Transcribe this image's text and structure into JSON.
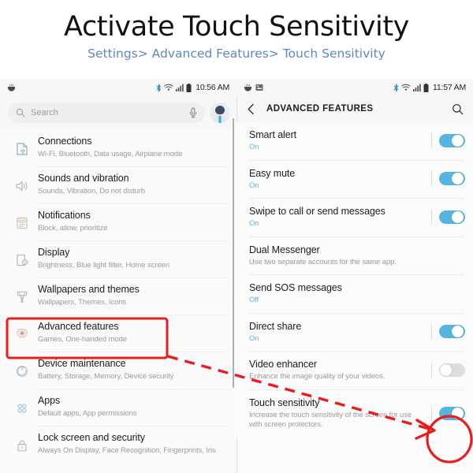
{
  "header": {
    "title": "Activate Touch Sensitivity",
    "breadcrumb": "Settings> Advanced Features> Touch Sensitivity",
    "title_color": "#111111",
    "breadcrumb_color": "#5b87c7"
  },
  "left_phone": {
    "status_bar": {
      "time": "10:56 AM",
      "icons": [
        "app-icon",
        "bluetooth-icon",
        "wifi-icon",
        "signal-icon",
        "battery-icon"
      ]
    },
    "search": {
      "placeholder": "Search",
      "search_icon": "search-icon",
      "mic_icon": "microphone-icon",
      "avatar": "user-avatar"
    },
    "items": [
      {
        "icon": "connections-icon",
        "title": "Connections",
        "sub": "Wi-Fi, Bluetooth, Data usage, Airplane mode"
      },
      {
        "icon": "sound-icon",
        "title": "Sounds and vibration",
        "sub": "Sounds, Vibration, Do not disturb"
      },
      {
        "icon": "notifications-icon",
        "title": "Notifications",
        "sub": "Block, allow, prioritize"
      },
      {
        "icon": "display-icon",
        "title": "Display",
        "sub": "Brightness, Blue light filter, Home screen"
      },
      {
        "icon": "wallpaper-brush-icon",
        "title": "Wallpapers and themes",
        "sub": "Wallpapers, Themes, Icons"
      },
      {
        "icon": "advanced-features-icon",
        "title": "Advanced features",
        "sub": "Games, One-handed mode"
      },
      {
        "icon": "device-maintenance-icon",
        "title": "Device maintenance",
        "sub": "Battery, Storage, Memory, Device security"
      },
      {
        "icon": "apps-icon",
        "title": "Apps",
        "sub": "Default apps, App permissions"
      },
      {
        "icon": "lock-icon",
        "title": "Lock screen and security",
        "sub": "Always On Display, Face Recognition, Fingerprints, Iris"
      }
    ]
  },
  "right_phone": {
    "status_bar": {
      "time": "11:57 AM",
      "icons": [
        "app-icon",
        "gallery-icon",
        "bluetooth-icon",
        "wifi-icon",
        "signal-icon",
        "battery-icon"
      ]
    },
    "app_bar": {
      "back_icon": "chevron-left-icon",
      "title": "ADVANCED FEATURES",
      "search_icon": "search-icon"
    },
    "items": [
      {
        "title": "Smart alert",
        "sub": "On",
        "sub_kind": "state",
        "toggle": "on"
      },
      {
        "title": "Easy mute",
        "sub": "On",
        "sub_kind": "state",
        "toggle": "on"
      },
      {
        "title": "Swipe to call or send messages",
        "sub": "On",
        "sub_kind": "state",
        "toggle": "on"
      },
      {
        "title": "Dual Messenger",
        "sub": "Use two separate accounts for the same app.",
        "sub_kind": "desc",
        "toggle": "none"
      },
      {
        "title": "Send SOS messages",
        "sub": "Off",
        "sub_kind": "state",
        "toggle": "none"
      },
      {
        "title": "Direct share",
        "sub": "On",
        "sub_kind": "state",
        "toggle": "on"
      },
      {
        "title": "Video enhancer",
        "sub": "Enhance the image quality of your videos.",
        "sub_kind": "desc",
        "toggle": "off"
      },
      {
        "title": "Touch sensitivity",
        "sub": "Increase the touch sensitivity of the screen for use with screen protectors.",
        "sub_kind": "desc",
        "toggle": "on"
      }
    ]
  },
  "annotations": {
    "highlight_color": "#e81e1e",
    "highlight_box_target": "Advanced features",
    "arrow_kind": "dashed-arrow",
    "circle_target": "Touch sensitivity toggle"
  }
}
